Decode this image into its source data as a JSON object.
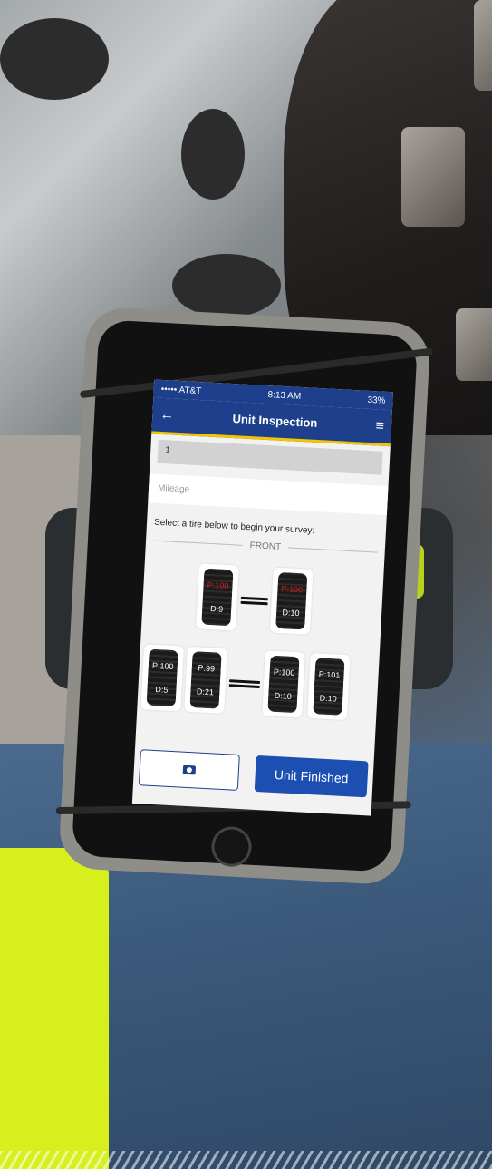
{
  "status_bar": {
    "carrier": "••••• AT&T",
    "time": "8:13 AM",
    "battery": "33%"
  },
  "navbar": {
    "title": "Unit Inspection"
  },
  "form": {
    "unit_value": "1",
    "mileage_placeholder": "Mileage"
  },
  "survey": {
    "prompt": "Select a tire below to begin your survey:",
    "front_label": "FRONT"
  },
  "front_tires": [
    {
      "pressure": "P:100",
      "depth": "D:9",
      "pressure_alert": true
    },
    {
      "pressure": "P:100",
      "depth": "D:10",
      "pressure_alert": true
    }
  ],
  "rear_tires": [
    {
      "pressure": "P:100",
      "depth": "D:5"
    },
    {
      "pressure": "P:99",
      "depth": "D:21"
    },
    {
      "pressure": "P:100",
      "depth": "D:10"
    },
    {
      "pressure": "P:101",
      "depth": "D:10"
    }
  ],
  "actions": {
    "finish_label": "Unit Finished"
  },
  "colors": {
    "nav": "#1d3f8c",
    "accent": "#f2c500",
    "alert": "#e01b1b",
    "button": "#1d4fb3"
  },
  "icons": {
    "back": "back-arrow-icon",
    "menu": "hamburger-menu-icon",
    "camera": "camera-icon"
  }
}
